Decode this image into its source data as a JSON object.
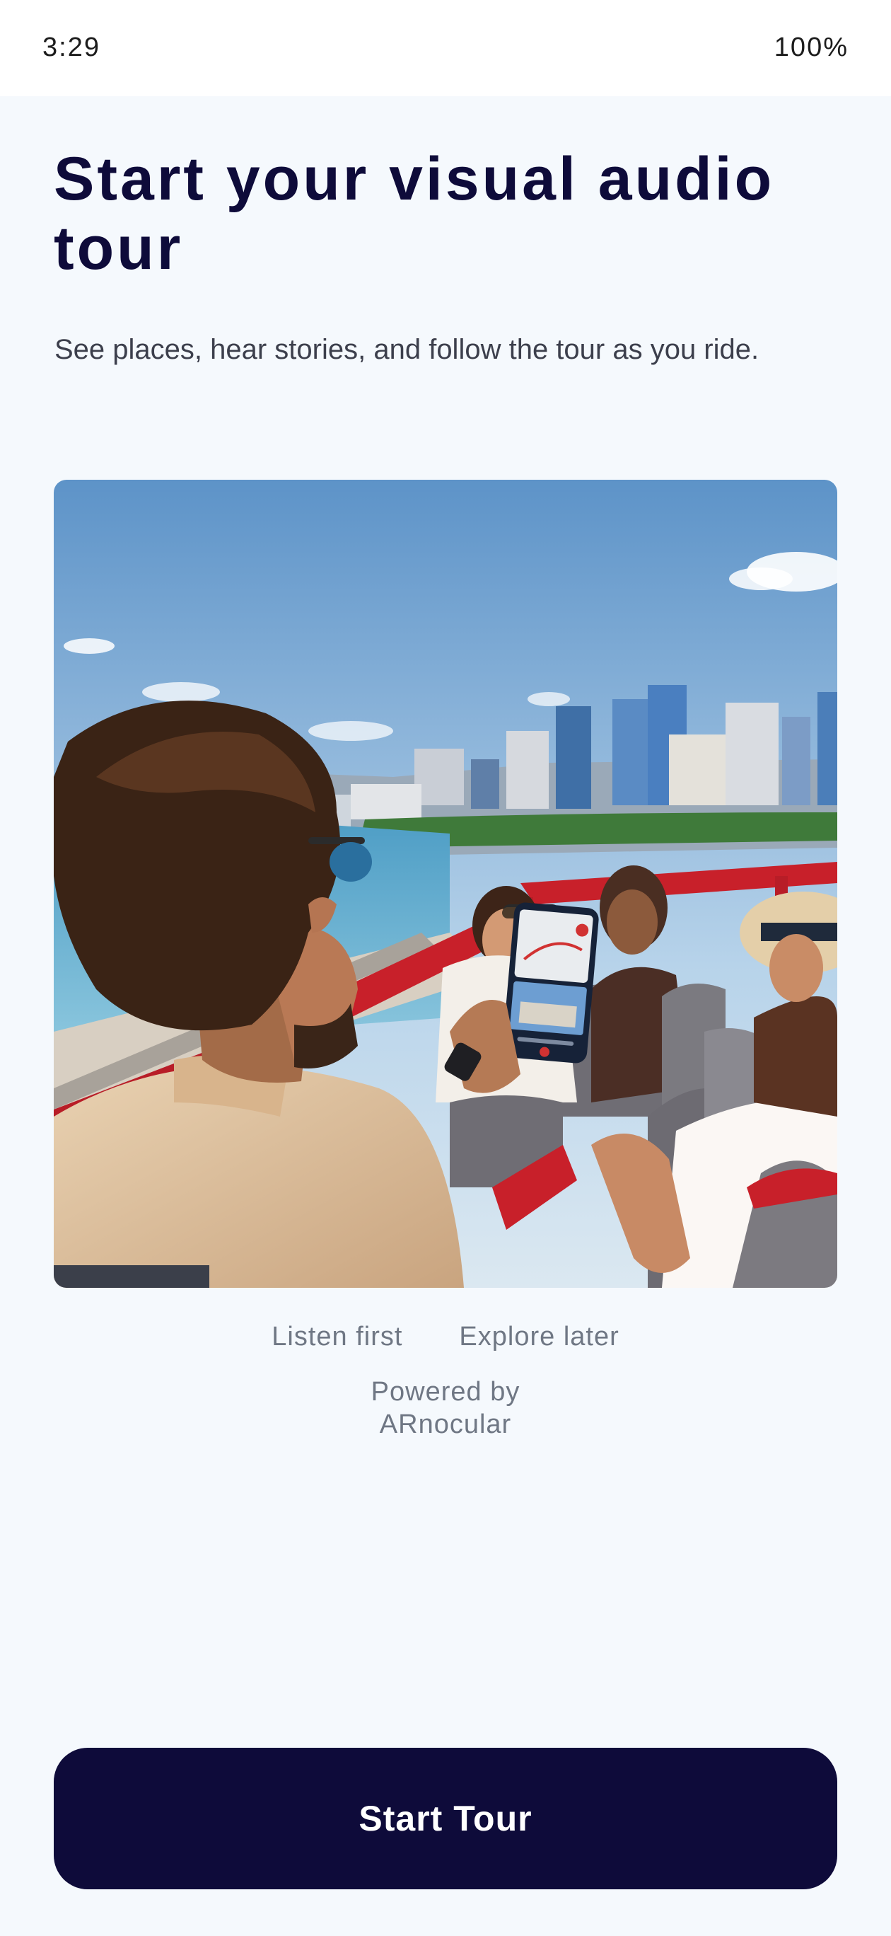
{
  "status_bar": {
    "time": "3:29",
    "battery": "100%"
  },
  "header": {
    "title": "Start your visual audio tour",
    "subtitle": "See places, hear stories, and follow the tour as you ride."
  },
  "taglines": {
    "first": "Listen first",
    "second": "Explore later"
  },
  "powered_by": {
    "line1": "Powered by",
    "line2": "ARnocular"
  },
  "cta": {
    "label": "Start Tour"
  },
  "colors": {
    "primary": "#0e0b3a",
    "background": "#f5f9fd",
    "muted_text": "#6f7784"
  }
}
